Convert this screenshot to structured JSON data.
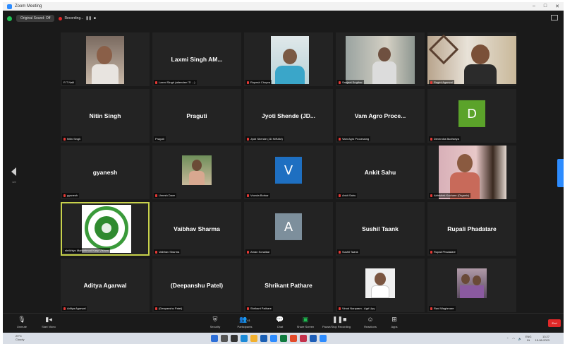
{
  "window": {
    "title": "Zoom Meeting"
  },
  "topbar": {
    "audio_label": "Original Sound: Off",
    "recording_label": "Recording..."
  },
  "participants": [
    {
      "name": "R T Nalli",
      "type": "photo"
    },
    {
      "name": "Laxmi Singh (attendee ITI ...)",
      "display": "Laxmi Singh AM...",
      "type": "name"
    },
    {
      "name": "Rupesh Chopra",
      "type": "photo"
    },
    {
      "name": "Sanjeet Sngthar",
      "type": "photo"
    },
    {
      "name": "Ragini Agarwal",
      "type": "photo"
    },
    {
      "name": "Nitin Singh",
      "display": "Nitin Singh",
      "type": "name"
    },
    {
      "name": "Praguti",
      "display": "Praguti",
      "type": "name"
    },
    {
      "name": "Jyoti Shende (JD NIRAM)",
      "display": "Jyoti Shende (JD...",
      "type": "name"
    },
    {
      "name": "Vam Agro Processing",
      "display": "Vam Agro Proce...",
      "type": "name"
    },
    {
      "name": "Devendra Budhwlya",
      "initial": "D",
      "color": "#5ba32a",
      "type": "avatar"
    },
    {
      "name": "gyanesh",
      "display": "gyanesh",
      "type": "name"
    },
    {
      "name": "Umesh Dave",
      "type": "photo"
    },
    {
      "name": "Vrunda Borkar",
      "initial": "V",
      "color": "#1e6fc1",
      "type": "avatar"
    },
    {
      "name": "Ankit Sahu",
      "display": "Ankit Sahu",
      "type": "name"
    },
    {
      "name": "Abhishek Kochare (Organic)",
      "type": "photo"
    },
    {
      "name": "shrikhiyo Mahantmod Kasy Vishwa",
      "type": "logo",
      "active": true
    },
    {
      "name": "Vaibhav Sharma",
      "display": "Vaibhav Sharma",
      "type": "name"
    },
    {
      "name": "Aman Sonalkar",
      "initial": "A",
      "color": "#7d8f9c",
      "type": "avatar"
    },
    {
      "name": "Sushil Taank",
      "display": "Sushil Taank",
      "type": "name"
    },
    {
      "name": "Rupali Phadatare",
      "display": "Rupali Phadatare",
      "type": "name"
    },
    {
      "name": "Aditya Agarwal",
      "display": "Aditya Agarwal",
      "type": "name"
    },
    {
      "name": "(Deepanshu Patel)",
      "display": "(Deepanshu Patel)",
      "type": "name"
    },
    {
      "name": "Shrikant Pathare",
      "display": "Shrikant Pathare",
      "type": "name"
    },
    {
      "name": "Vinod Narpaam - Agri Upy",
      "type": "photo"
    },
    {
      "name": "Ravi Waghmare",
      "type": "photo"
    }
  ],
  "pager": {
    "left": "1/2"
  },
  "toolbar": {
    "unmute": "Unmute",
    "start_video": "Start Video",
    "security": "Security",
    "participants": "Participants",
    "participants_count": "41",
    "chat": "Chat",
    "share_screen": "Share Screen",
    "recording": "Pause/Stop Recording",
    "reactions": "Reactions",
    "apps": "Apps",
    "end": "End"
  },
  "taskbar": {
    "weather_temp": "29°C",
    "weather_desc": "Cloudy",
    "lang": "ENG",
    "lang_region": "IN",
    "time": "13:27",
    "date": "15-08-2023"
  },
  "colors": {
    "accent": "#2d8cff",
    "active_speaker": "#c8d24c",
    "end": "#e02828"
  }
}
